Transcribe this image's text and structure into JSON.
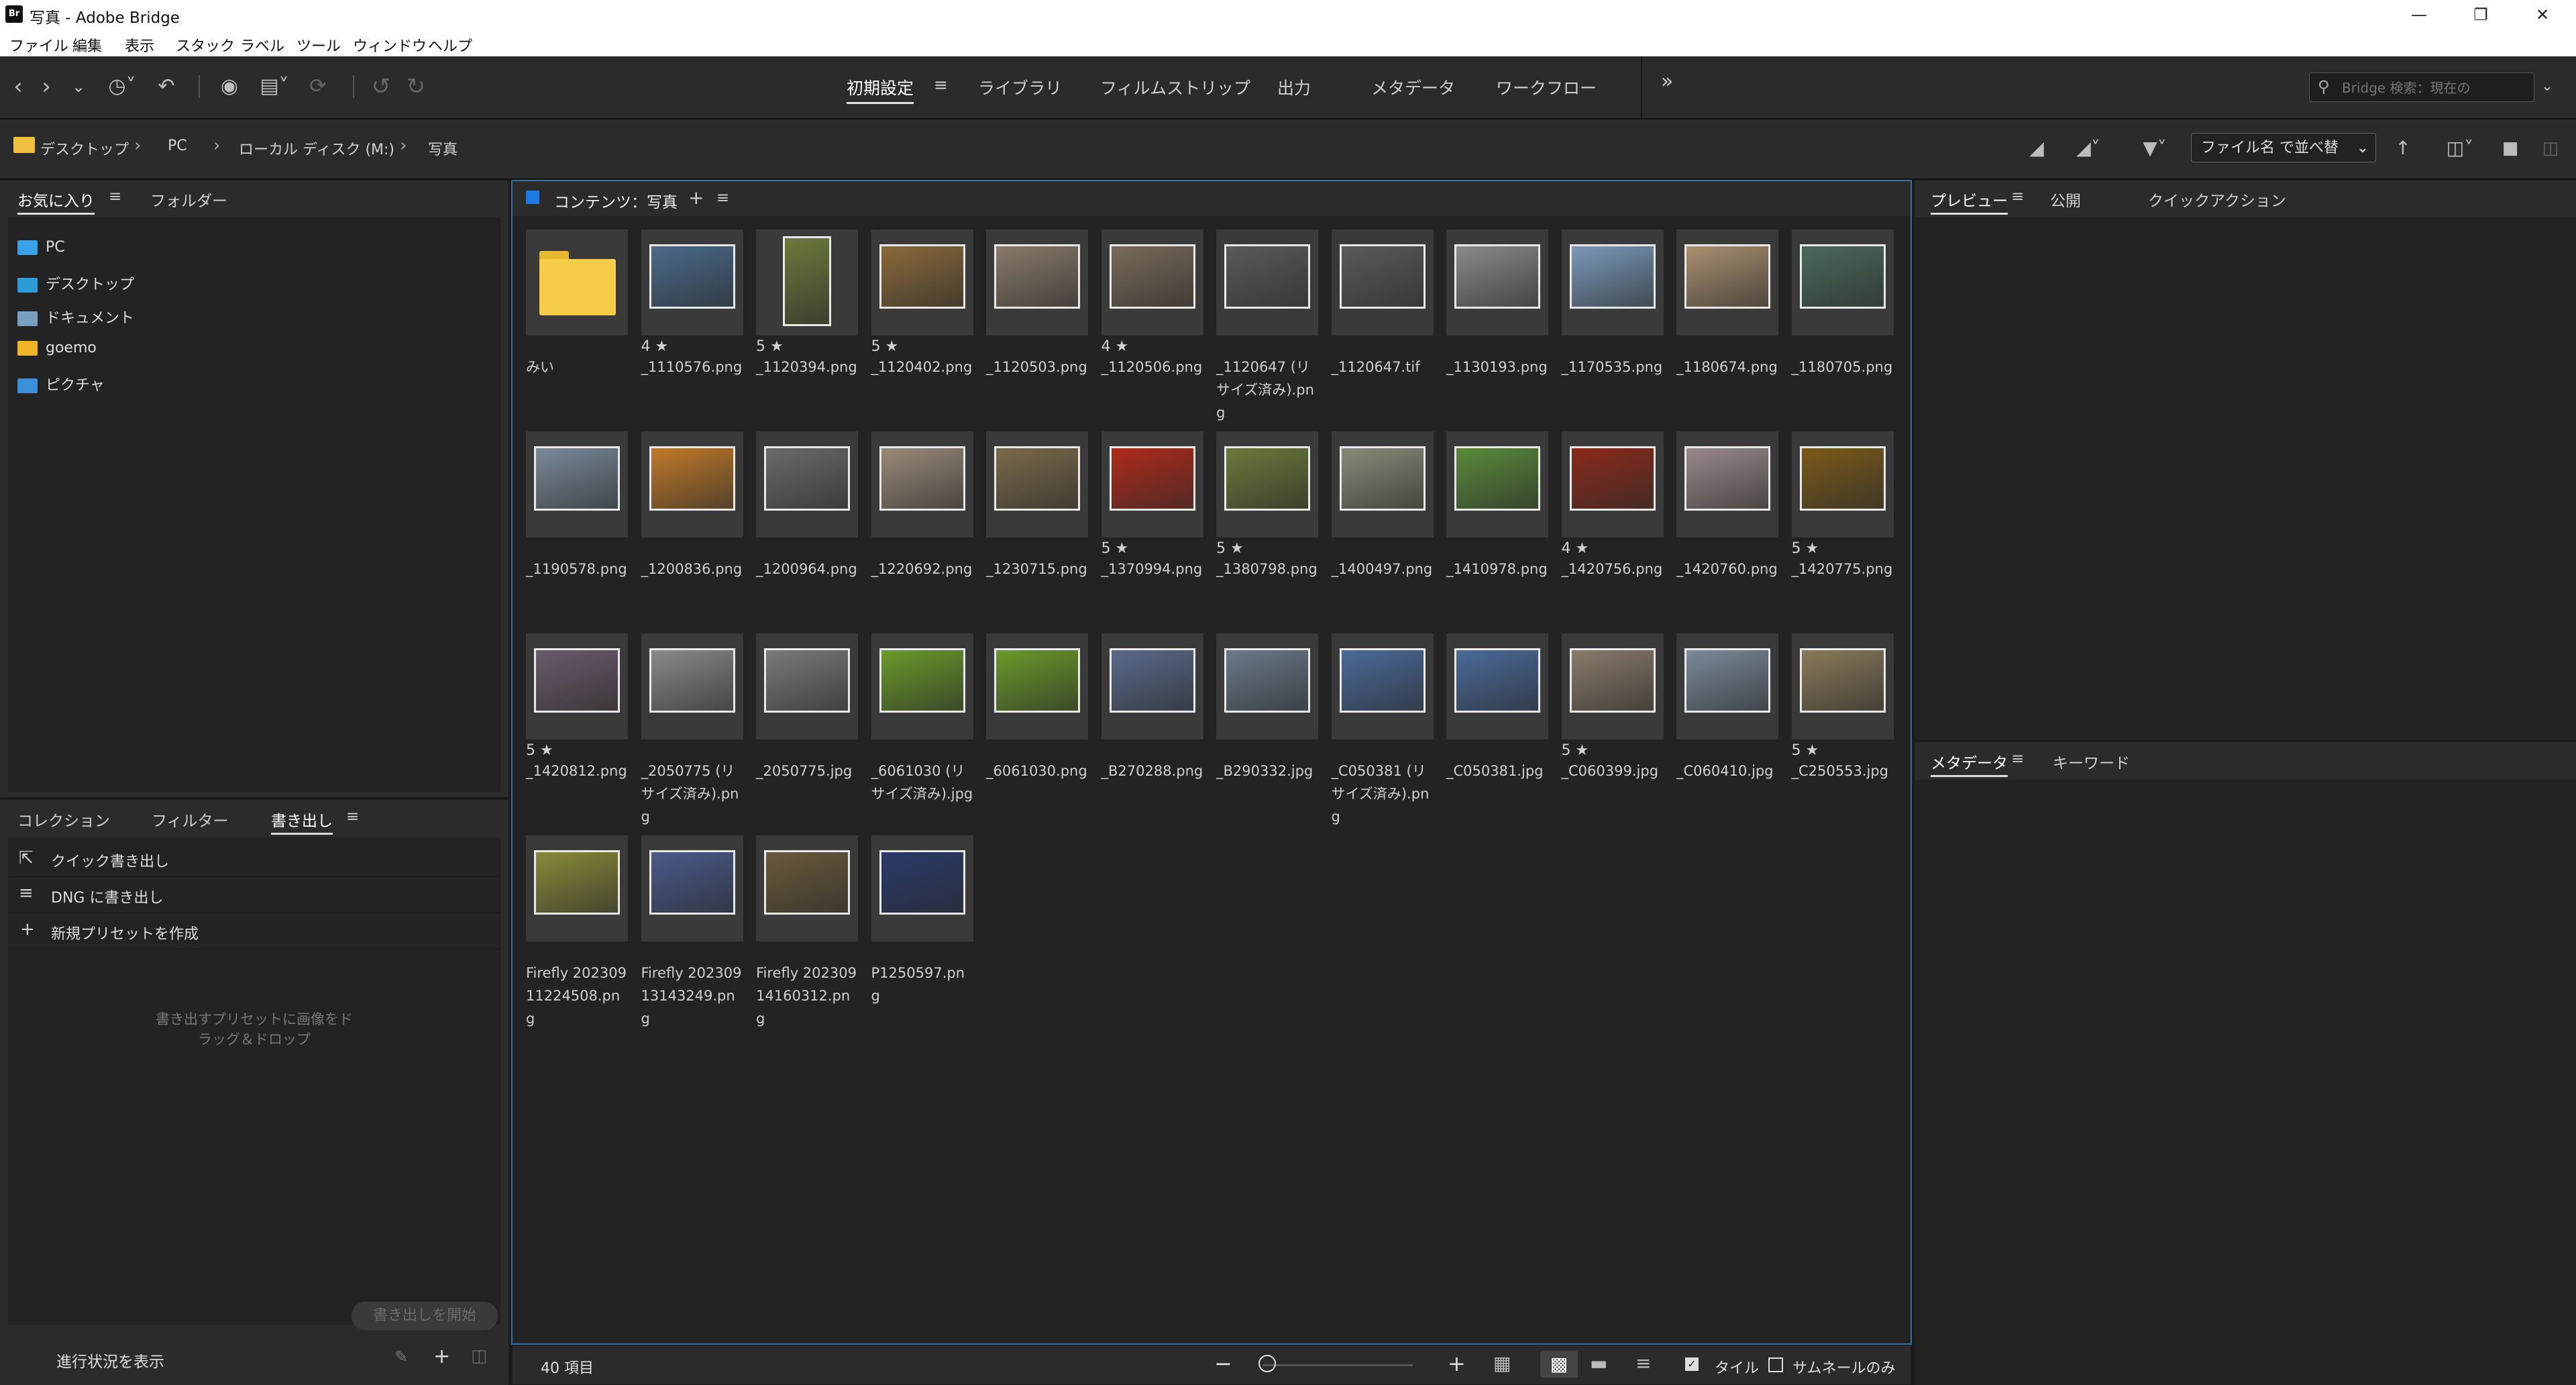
{
  "window": {
    "title": "写真 - Adobe Bridge",
    "logo": "Br"
  },
  "menu": [
    "ファイル",
    "編集",
    "表示",
    "スタック",
    "ラベル",
    "ツール",
    "ウィンドウ",
    "ヘルプ"
  ],
  "workspaces": [
    "初期設定",
    "ライブラリ",
    "フィルムストリップ",
    "出力",
    "メタデータ",
    "ワークフロー"
  ],
  "search": {
    "placeholder": "Bridge 検索：現在の"
  },
  "breadcrumb": [
    "デスクトップ",
    "PC",
    "ローカル ディスク (M:)",
    "写真"
  ],
  "sort": {
    "label": "ファイル名 で並べ替"
  },
  "left_panel": {
    "tabs": [
      "お気に入り",
      "フォルダー"
    ],
    "favorites": [
      {
        "label": "PC",
        "color": "#3aa0e8"
      },
      {
        "label": "デスクトップ",
        "color": "#2e9ad8"
      },
      {
        "label": "ドキュメント",
        "color": "#7aa0c0"
      },
      {
        "label": "goemo",
        "color": "#f0b429"
      },
      {
        "label": "ピクチャ",
        "color": "#3a8fd8"
      }
    ]
  },
  "export_panel": {
    "tabs": [
      "コレクション",
      "フィルター",
      "書き出し"
    ],
    "items": [
      {
        "label": "クイック書き出し",
        "icon": "export-icon"
      },
      {
        "label": "DNG に書き出し",
        "icon": "list-icon"
      },
      {
        "label": "新規プリセットを作成",
        "icon": "plus-icon"
      }
    ],
    "hint": [
      "書き出すプリセットに画像をド",
      "ラッグ＆ドロップ"
    ],
    "start_button": "書き出しを開始",
    "progress_label": "進行状況を表示"
  },
  "content": {
    "title": "コンテンツ：写真",
    "count_label": "40 項目",
    "tile_label": "タイル",
    "thumb_only_label": "サムネールのみ",
    "items": [
      {
        "name": "みい",
        "rating": "",
        "folder": true
      },
      {
        "name": "_1110576.png",
        "rating": "4 ★",
        "color": "#4a6a8a"
      },
      {
        "name": "_1120394.png",
        "rating": "5 ★",
        "color": "#6a7a3a",
        "portrait": true
      },
      {
        "name": "_1120402.png",
        "rating": "5 ★",
        "color": "#8a6a3a"
      },
      {
        "name": "_1120503.png",
        "rating": "",
        "color": "#8a7a6a"
      },
      {
        "name": "_1120506.png",
        "rating": "4 ★",
        "color": "#7a6a5a"
      },
      {
        "name": "_1120647 (リサイズ済み).png",
        "rating": "",
        "color": "#5a5a5a"
      },
      {
        "name": "_1120647.tif",
        "rating": "",
        "color": "#5a5a5a"
      },
      {
        "name": "_1130193.png",
        "rating": "",
        "color": "#8a8a8a"
      },
      {
        "name": "_1170535.png",
        "rating": "",
        "color": "#7a9aba"
      },
      {
        "name": "_1180674.png",
        "rating": "",
        "color": "#aa9070"
      },
      {
        "name": "_1180705.png",
        "rating": "",
        "color": "#4a6a5a"
      },
      {
        "name": "_1190578.png",
        "rating": "",
        "color": "#7a8a9a"
      },
      {
        "name": "_1200836.png",
        "rating": "",
        "color": "#c07a2a"
      },
      {
        "name": "_1200964.png",
        "rating": "",
        "color": "#6a6a6a"
      },
      {
        "name": "_1220692.png",
        "rating": "",
        "color": "#9a8a7a"
      },
      {
        "name": "_1230715.png",
        "rating": "",
        "color": "#7a6a4a"
      },
      {
        "name": "_1370994.png",
        "rating": "5 ★",
        "color": "#b02a1a"
      },
      {
        "name": "_1380798.png",
        "rating": "5 ★",
        "color": "#6a7a3a"
      },
      {
        "name": "_1400497.png",
        "rating": "",
        "color": "#8a8a7a"
      },
      {
        "name": "_1410978.png",
        "rating": "",
        "color": "#5a8a3a"
      },
      {
        "name": "_1420756.png",
        "rating": "4 ★",
        "color": "#8a2a1a"
      },
      {
        "name": "_1420760.png",
        "rating": "",
        "color": "#9a8a8a"
      },
      {
        "name": "_1420775.png",
        "rating": "5 ★",
        "color": "#7a5a1a"
      },
      {
        "name": "_1420812.png",
        "rating": "5 ★",
        "color": "#6a5a6a"
      },
      {
        "name": "_2050775 (リサイズ済み).png",
        "rating": "",
        "color": "#8a8a8a"
      },
      {
        "name": "_2050775.jpg",
        "rating": "",
        "color": "#7a7a7a"
      },
      {
        "name": "_6061030 (リサイズ済み).jpg",
        "rating": "",
        "color": "#6a9a2a"
      },
      {
        "name": "_6061030.png",
        "rating": "",
        "color": "#6a9a2a"
      },
      {
        "name": "_B270288.png",
        "rating": "",
        "color": "#5a6a8a"
      },
      {
        "name": "_B290332.jpg",
        "rating": "",
        "color": "#6a7a8a"
      },
      {
        "name": "_C050381 (リサイズ済み).png",
        "rating": "",
        "color": "#4a6a9a"
      },
      {
        "name": "_C050381.jpg",
        "rating": "",
        "color": "#4a6a9a"
      },
      {
        "name": "_C060399.jpg",
        "rating": "5 ★",
        "color": "#8a7a6a"
      },
      {
        "name": "_C060410.jpg",
        "rating": "",
        "color": "#7a8a9a"
      },
      {
        "name": "_C250553.jpg",
        "rating": "5 ★",
        "color": "#8a7a5a"
      },
      {
        "name": "Firefly 20230911224508.png",
        "rating": "",
        "color": "#8a8a3a"
      },
      {
        "name": "Firefly 20230913143249.png",
        "rating": "",
        "color": "#4a5a8a"
      },
      {
        "name": "Firefly 20230914160312.png",
        "rating": "",
        "color": "#6a5a3a"
      },
      {
        "name": "P1250597.png",
        "rating": "",
        "color": "#2a3a6a"
      }
    ]
  },
  "right_panel": {
    "top_tabs": [
      "プレビュー",
      "公開",
      "クイックアクション"
    ],
    "bottom_tabs": [
      "メタデータ",
      "キーワード"
    ]
  }
}
